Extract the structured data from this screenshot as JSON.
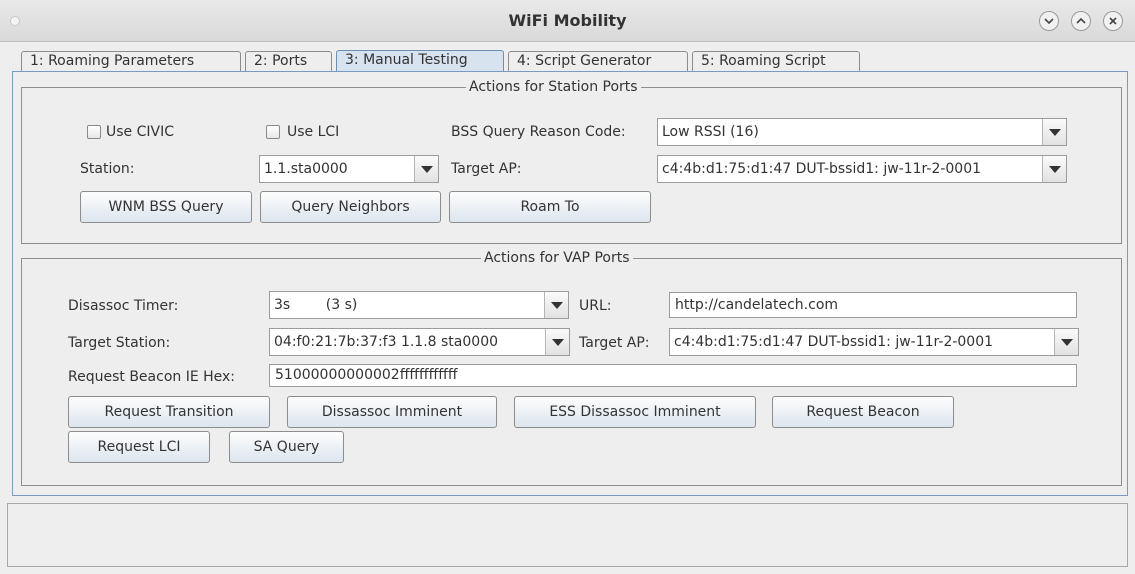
{
  "window": {
    "title": "WiFi Mobility",
    "controls": [
      "chevron-down-icon",
      "chevron-up-icon",
      "close-icon"
    ]
  },
  "tabs": [
    {
      "label": "1: Roaming Parameters",
      "active": false
    },
    {
      "label": "2: Ports",
      "active": false
    },
    {
      "label": "3: Manual Testing",
      "active": true
    },
    {
      "label": "4: Script Generator",
      "active": false
    },
    {
      "label": "5: Roaming Script",
      "active": false
    }
  ],
  "station_section": {
    "title": "Actions for Station Ports",
    "use_civic_label": "Use CIVIC",
    "use_lci_label": "Use LCI",
    "bss_reason_label": "BSS Query Reason Code:",
    "bss_reason_value": "Low RSSI (16)",
    "station_label": "Station:",
    "station_value": "1.1.sta0000",
    "target_ap_label": "Target AP:",
    "target_ap_value": "c4:4b:d1:75:d1:47 DUT-bssid1: jw-11r-2-0001",
    "buttons": {
      "wnm_bss_query": "WNM BSS Query",
      "query_neighbors": "Query Neighbors",
      "roam_to": "Roam To"
    }
  },
  "vap_section": {
    "title": "Actions for VAP Ports",
    "disassoc_timer_label": "Disassoc Timer:",
    "disassoc_timer_value": "3s        (3 s)",
    "url_label": "URL:",
    "url_value": "http://candelatech.com",
    "target_station_label": "Target Station:",
    "target_station_value": "04:f0:21:7b:37:f3 1.1.8 sta0000",
    "target_ap_label": "Target AP:",
    "target_ap_value": "c4:4b:d1:75:d1:47 DUT-bssid1: jw-11r-2-0001",
    "beacon_ie_label": "Request Beacon IE Hex:",
    "beacon_ie_value": "51000000000002ffffffffffff",
    "buttons": {
      "request_transition": "Request Transition",
      "dissassoc_imminent": "Dissassoc Imminent",
      "ess_dissassoc_imminent": "ESS Dissassoc Imminent",
      "request_beacon": "Request Beacon",
      "request_lci": "Request LCI",
      "sa_query": "SA Query"
    }
  }
}
